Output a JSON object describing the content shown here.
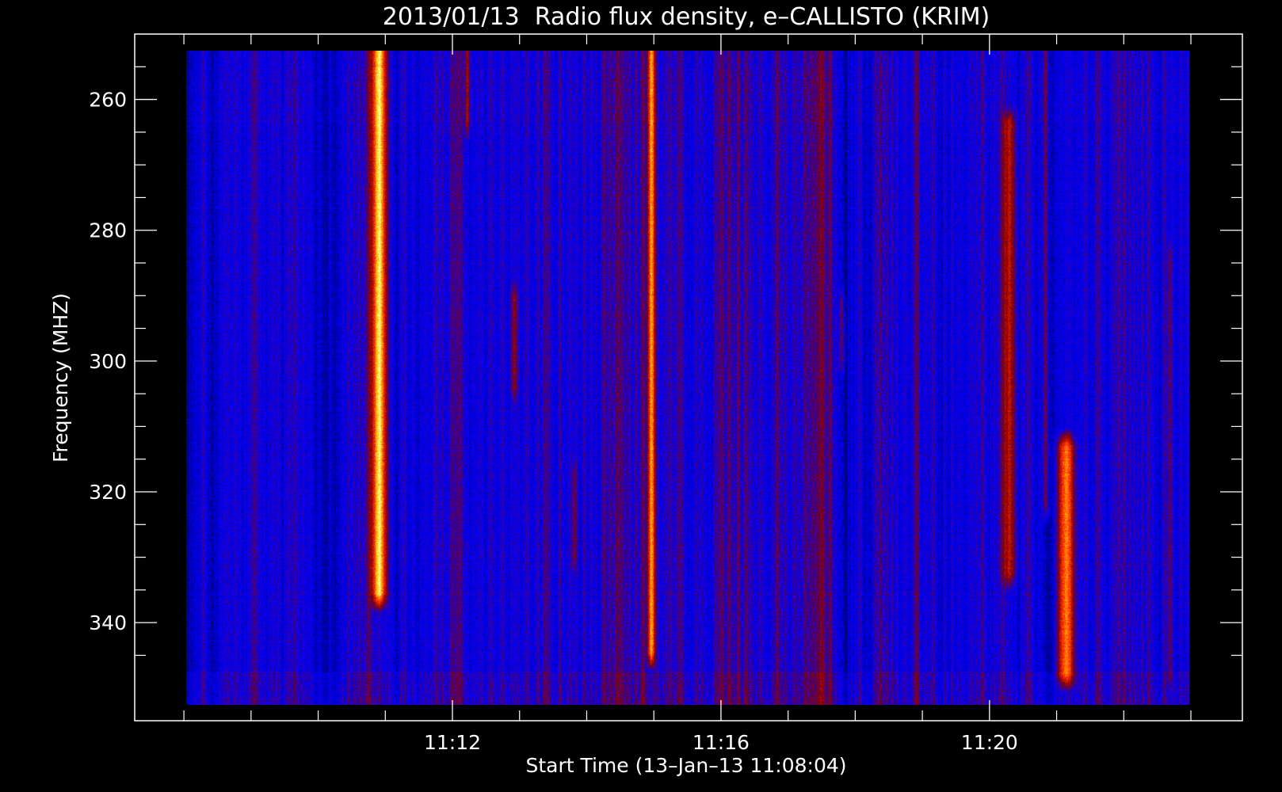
{
  "chart_data": {
    "type": "heatmap",
    "title": "2013/01/13  Radio flux density, e–CALLISTO (KRIM)",
    "xlabel": "Start Time (13–Jan–13 11:08:04)",
    "ylabel": "Frequency (MHZ)",
    "x_unit": "minutes after 11:08:04",
    "xlim": [
      -0.8,
      15.7
    ],
    "ylim": [
      250,
      355
    ],
    "y_inverted": true,
    "data_extent": {
      "x": [
        0,
        15
      ],
      "y": [
        251,
        350
      ]
    },
    "x_ticks": [
      {
        "value": 3.933,
        "label": "11:12"
      },
      {
        "value": 7.933,
        "label": "11:16"
      },
      {
        "value": 11.933,
        "label": "11:20"
      }
    ],
    "x_minor_ticks": [
      -0.067,
      0.933,
      1.933,
      2.933,
      4.933,
      5.933,
      6.933,
      8.933,
      9.933,
      10.933,
      12.933,
      13.933,
      14.933
    ],
    "y_ticks": [
      {
        "value": 260,
        "label": "260"
      },
      {
        "value": 280,
        "label": "280"
      },
      {
        "value": 300,
        "label": "300"
      },
      {
        "value": 320,
        "label": "320"
      },
      {
        "value": 340,
        "label": "340"
      }
    ],
    "y_minor_ticks": [
      255,
      265,
      270,
      275,
      285,
      290,
      295,
      305,
      310,
      315,
      325,
      330,
      335,
      345
    ],
    "colormap": [
      "#000000",
      "#0000ff",
      "#8a0000",
      "#ff2a00",
      "#ffaa00",
      "#ffff80"
    ],
    "background_level": 0.3,
    "bursts": [
      {
        "time": 2.88,
        "f_start": 251,
        "f_end": 333,
        "width": 0.1,
        "peak": 1.0
      },
      {
        "time": 6.95,
        "f_start": 251,
        "f_end": 342,
        "width": 0.05,
        "peak": 0.9
      },
      {
        "time": 13.15,
        "f_start": 311,
        "f_end": 345,
        "width": 0.12,
        "peak": 0.85
      },
      {
        "time": 12.3,
        "f_start": 262,
        "f_end": 330,
        "width": 0.1,
        "peak": 0.6
      },
      {
        "time": 12.85,
        "f_start": 251,
        "f_end": 320,
        "width": 0.05,
        "peak": 0.55
      },
      {
        "time": 4.2,
        "f_start": 251,
        "f_end": 262,
        "width": 0.04,
        "peak": 0.55
      },
      {
        "time": 4.9,
        "f_start": 288,
        "f_end": 302,
        "width": 0.05,
        "peak": 0.5
      },
      {
        "time": 9.8,
        "f_start": 289,
        "f_end": 298,
        "width": 0.04,
        "peak": 0.5
      },
      {
        "time": 5.8,
        "f_start": 315,
        "f_end": 328,
        "width": 0.04,
        "peak": 0.45
      },
      {
        "time": 14.7,
        "f_start": 282,
        "f_end": 345,
        "width": 0.04,
        "peak": 0.45
      }
    ]
  }
}
